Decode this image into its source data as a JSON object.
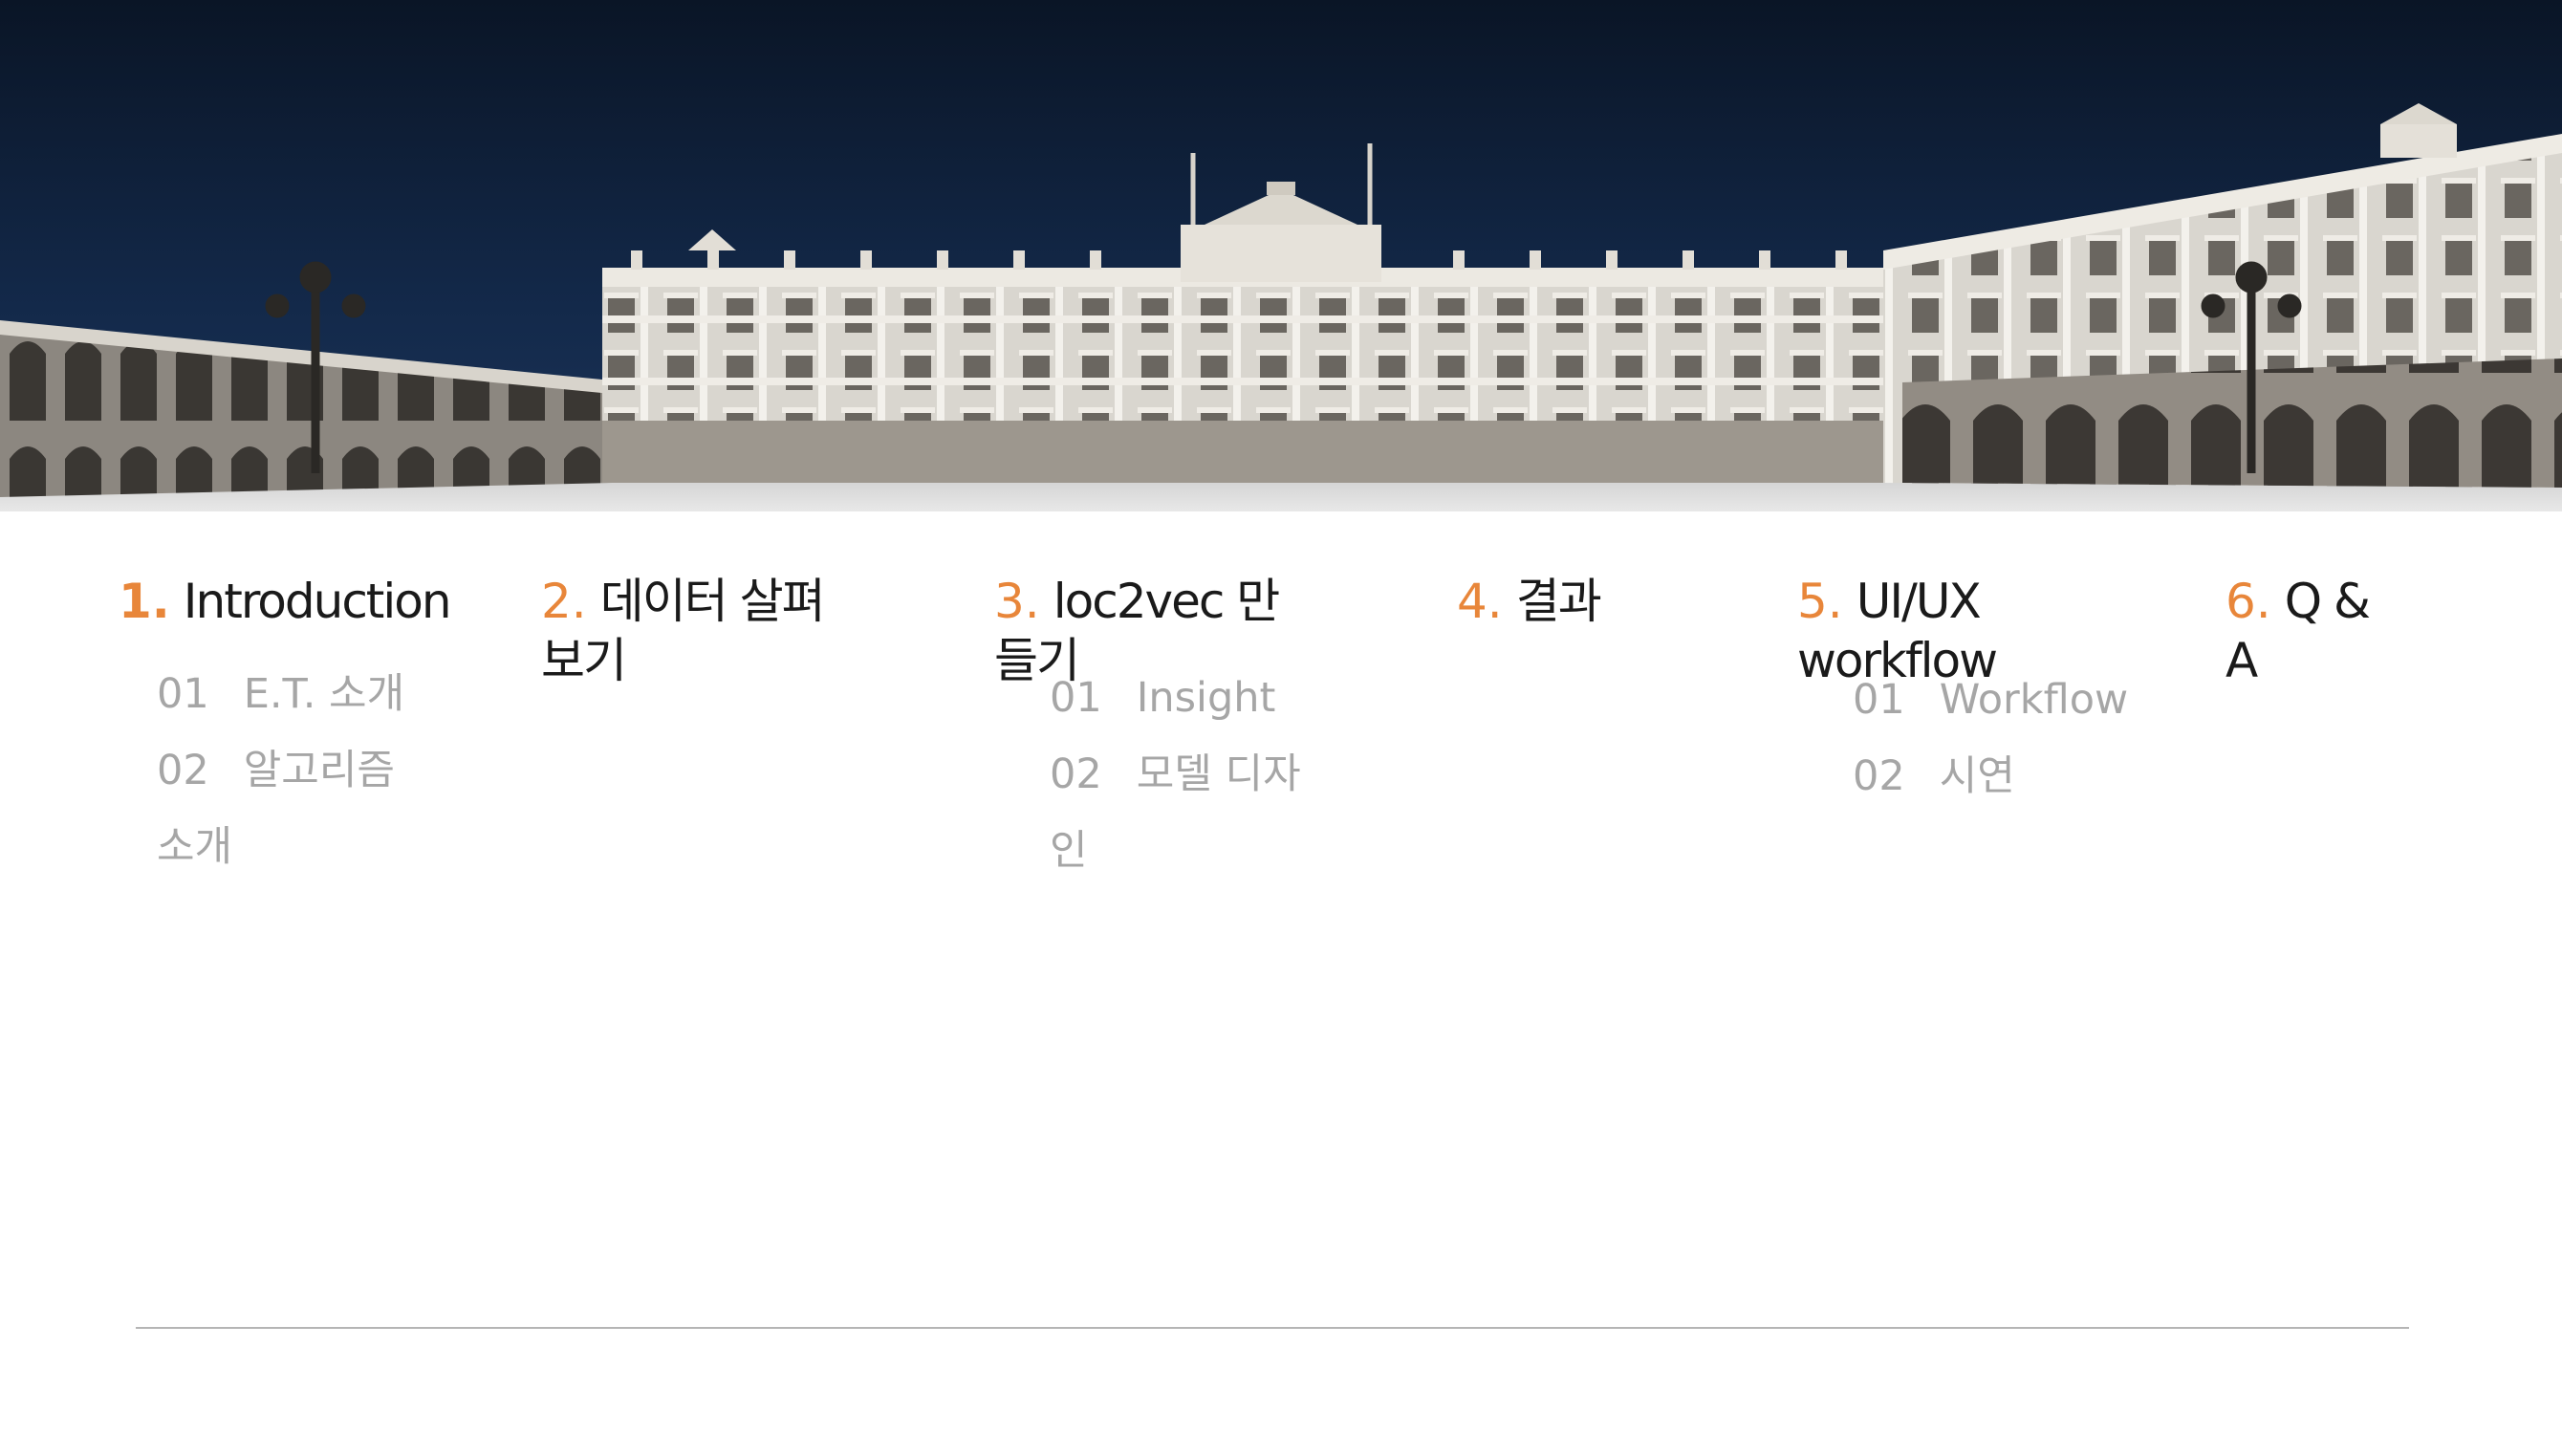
{
  "colors": {
    "accent": "#e8863a",
    "title": "#1a1a1a",
    "subitem": "#a6a6a6",
    "sky": "#0b1a30",
    "divider": "#b5b5b5"
  },
  "sections": [
    {
      "number": "1.",
      "title": "Introduction",
      "items": [
        {
          "index": "01",
          "label": "E.T. 소개"
        },
        {
          "index": "02",
          "label": "알고리즘 소개"
        }
      ]
    },
    {
      "number": "2.",
      "title": "데이터 살펴보기",
      "items": []
    },
    {
      "number": "3.",
      "title": "loc2vec 만들기",
      "items": [
        {
          "index": "01",
          "label": "Insight"
        },
        {
          "index": "02",
          "label": "모델 디자인"
        }
      ]
    },
    {
      "number": "4.",
      "title": "결과",
      "items": []
    },
    {
      "number": "5.",
      "title": "UI/UX workflow",
      "items": [
        {
          "index": "01",
          "label": "Workflow"
        },
        {
          "index": "02",
          "label": "시연"
        }
      ]
    },
    {
      "number": "6.",
      "title": "Q & A",
      "items": []
    }
  ]
}
